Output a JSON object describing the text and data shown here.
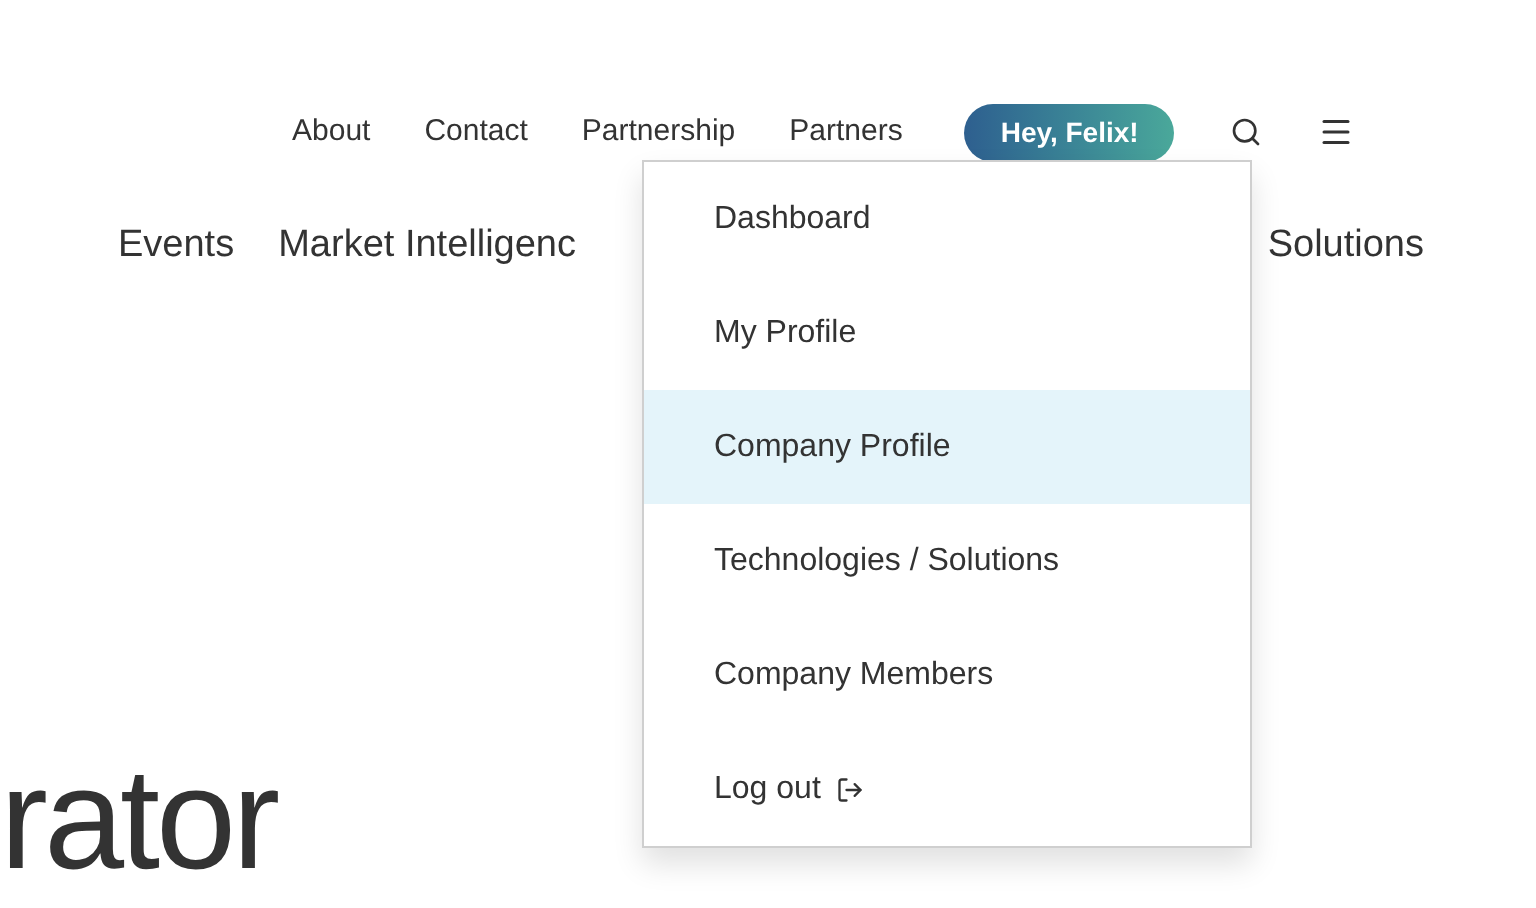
{
  "top_nav": {
    "links": [
      "About",
      "Contact",
      "Partnership",
      "Partners"
    ],
    "user_button": "Hey, Felix!"
  },
  "main_nav": [
    "Events",
    "Market Intelligenc",
    "Solutions"
  ],
  "user_menu": {
    "items": [
      {
        "label": "Dashboard",
        "selected": false,
        "kind": "link"
      },
      {
        "label": "My Profile",
        "selected": false,
        "kind": "link"
      },
      {
        "label": "Company Profile",
        "selected": true,
        "kind": "link"
      },
      {
        "label": "Technologies / Solutions",
        "selected": false,
        "kind": "link"
      },
      {
        "label": "Company Members",
        "selected": false,
        "kind": "link"
      },
      {
        "label": "Log out",
        "selected": false,
        "kind": "logout"
      }
    ]
  },
  "hero_heading": "rator"
}
